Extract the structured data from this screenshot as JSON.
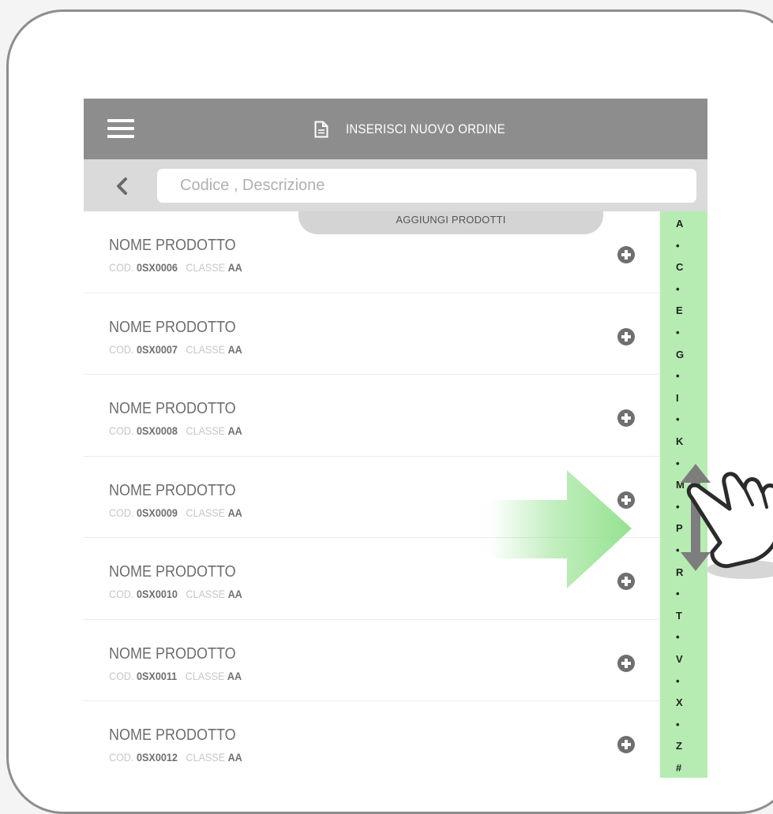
{
  "header": {
    "title": "INSERISCI NUOVO ORDINE",
    "menu_icon": "hamburger-icon",
    "title_icon": "document-icon"
  },
  "search": {
    "placeholder": "Codice , Descrizione",
    "value": ""
  },
  "add_products_label": "AGGIUNGI PRODOTTI",
  "code_label": "COD.",
  "class_label": "CLASSE",
  "products": [
    {
      "name": "NOME PRODOTTO",
      "code": "0SX0006",
      "class": "AA"
    },
    {
      "name": "NOME PRODOTTO",
      "code": "0SX0007",
      "class": "AA"
    },
    {
      "name": "NOME PRODOTTO",
      "code": "0SX0008",
      "class": "AA"
    },
    {
      "name": "NOME PRODOTTO",
      "code": "0SX0009",
      "class": "AA"
    },
    {
      "name": "NOME PRODOTTO",
      "code": "0SX0010",
      "class": "AA"
    },
    {
      "name": "NOME PRODOTTO",
      "code": "0SX0011",
      "class": "AA"
    },
    {
      "name": "NOME PRODOTTO",
      "code": "0SX0012",
      "class": "AA"
    }
  ],
  "alphabet_index": [
    "A",
    "•",
    "C",
    "•",
    "E",
    "•",
    "G",
    "•",
    "I",
    "•",
    "K",
    "•",
    "M",
    "•",
    "P",
    "•",
    "R",
    "•",
    "T",
    "•",
    "V",
    "•",
    "X",
    "•",
    "Z",
    "#"
  ],
  "colors": {
    "topbar": "#8d8d8d",
    "searchbar": "#dadada",
    "index_bar": "#b6ecb2",
    "gesture_arrow": "#8fe08a"
  }
}
